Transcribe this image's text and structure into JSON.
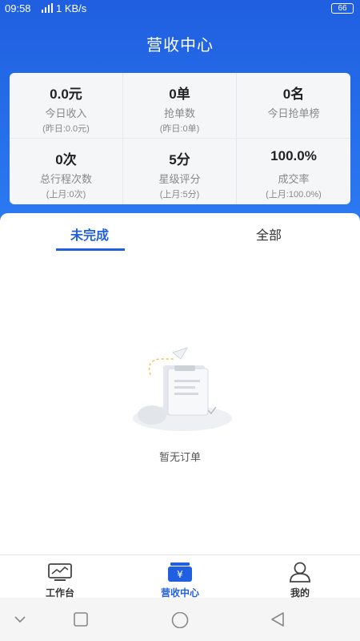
{
  "status_bar": {
    "time": "09:58",
    "network_speed": "1 KB/s",
    "battery": "66"
  },
  "header": {
    "title": "营收中心"
  },
  "stats": [
    {
      "value": "0.0元",
      "label": "今日收入",
      "compare": "(昨日:0.0元)"
    },
    {
      "value": "0单",
      "label": "抢单数",
      "compare": "(昨日:0单)"
    },
    {
      "value": "0名",
      "label": "今日抢单榜",
      "compare": ""
    },
    {
      "value": "0次",
      "label": "总行程次数",
      "compare": "(上月:0次)"
    },
    {
      "value": "5分",
      "label": "星级评分",
      "compare": "(上月:5分)"
    },
    {
      "value": "100.0%",
      "label": "成交率",
      "compare": "(上月:100.0%)"
    }
  ],
  "tabs": [
    {
      "label": "未完成",
      "active": true
    },
    {
      "label": "全部",
      "active": false
    }
  ],
  "empty_state": {
    "text": "暂无订单",
    "icon": "empty-orders-illustration"
  },
  "bottom_nav": [
    {
      "label": "工作台",
      "icon": "chart-monitor-icon",
      "active": false
    },
    {
      "label": "营收中心",
      "icon": "wallet-yuan-icon",
      "active": true
    },
    {
      "label": "我的",
      "icon": "user-icon",
      "active": false
    }
  ],
  "system_nav": [
    "collapse-chevron-icon",
    "recent-apps-icon",
    "home-icon",
    "back-icon"
  ],
  "colors": {
    "primary": "#1f5fe0",
    "hero_gradient_end": "#2c7bf2",
    "card_bg": "#f5f6f8"
  }
}
